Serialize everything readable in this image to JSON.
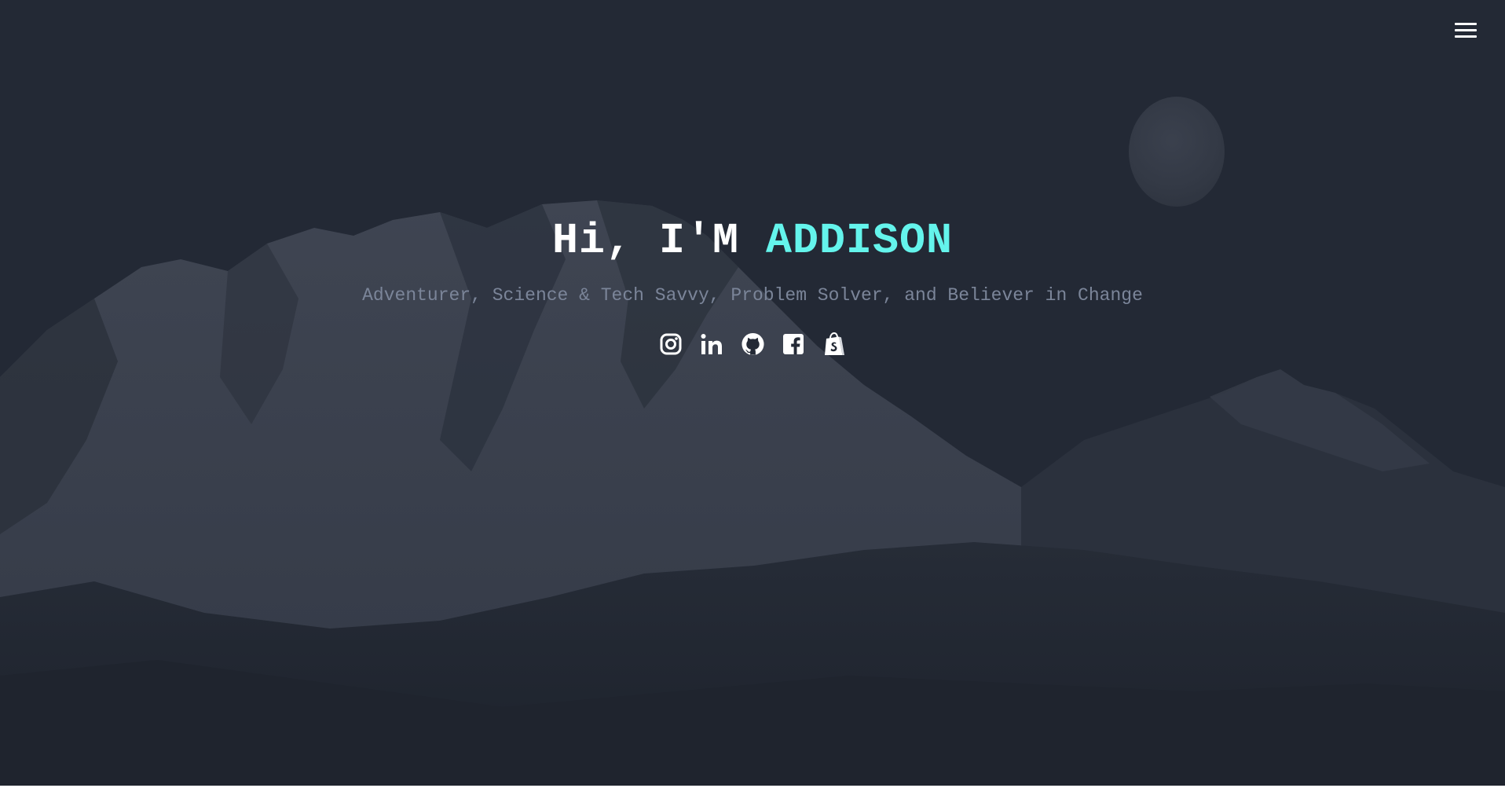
{
  "hero": {
    "greeting": "Hi, I'M ",
    "name": "ADDISON",
    "tagline": "Adventurer, Science & Tech Savvy, Problem Solver, and Believer in Change"
  },
  "nav": {
    "menu_icon": "hamburger-menu-icon"
  },
  "socials": [
    {
      "icon": "instagram-icon"
    },
    {
      "icon": "linkedin-icon"
    },
    {
      "icon": "github-icon"
    },
    {
      "icon": "facebook-icon"
    },
    {
      "icon": "shopify-icon"
    }
  ],
  "colors": {
    "background": "#232935",
    "accent": "#64f4ec",
    "tagline": "#7b8599",
    "headline": "#ffffff"
  }
}
